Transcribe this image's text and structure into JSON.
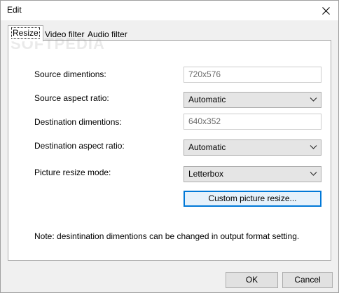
{
  "window": {
    "title": "Edit",
    "close_label": "×"
  },
  "tabs": [
    {
      "label": "Resize",
      "active": true
    },
    {
      "label": "Video filter",
      "active": false
    },
    {
      "label": "Audio filter",
      "active": false
    }
  ],
  "watermark": "SOFTPEDIA",
  "form": {
    "source_dimensions": {
      "label": "Source dimentions:",
      "value": "720x576"
    },
    "source_aspect": {
      "label": "Source aspect ratio:",
      "value": "Automatic"
    },
    "dest_dimensions": {
      "label": "Destination dimentions:",
      "value": "640x352"
    },
    "dest_aspect": {
      "label": "Destination aspect ratio:",
      "value": "Automatic"
    },
    "resize_mode": {
      "label": "Picture resize mode:",
      "value": "Letterbox"
    },
    "custom_button": "Custom picture resize...",
    "note": "Note: desintination dimentions can be changed in output format setting."
  },
  "buttons": {
    "ok": "OK",
    "cancel": "Cancel"
  },
  "icons": {
    "close": "close-icon",
    "dropdown": "chevron-down-icon"
  }
}
